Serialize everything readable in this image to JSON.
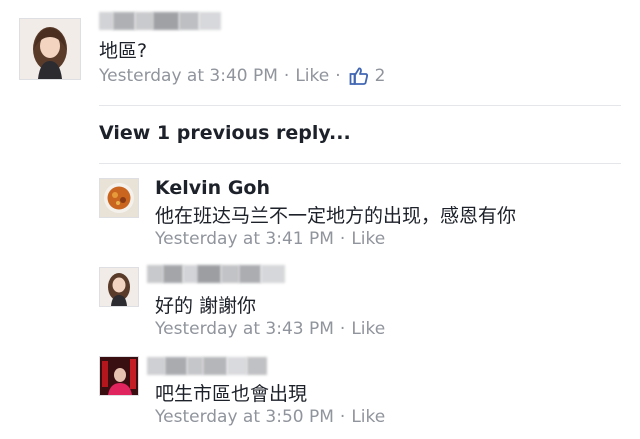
{
  "comment": {
    "author_blurred": true,
    "text": "地區?",
    "timestamp": "Yesterday at 3:40 PM",
    "like_label": "Like",
    "like_count": "2",
    "like_icon": "thumbs-up-icon",
    "accent_color": "#4267b2"
  },
  "replies_toggle": {
    "label": "View 1 previous reply..."
  },
  "replies": [
    {
      "author": "Kelvin Goh",
      "text": "他在班达马兰不一定地方的出现，感恩有你",
      "timestamp": "Yesterday at 3:41 PM",
      "like_label": "Like"
    },
    {
      "author_blurred": true,
      "text": "好的 謝謝你",
      "timestamp": "Yesterday at 3:43 PM",
      "like_label": "Like"
    },
    {
      "author_blurred": true,
      "text": "吧生市區也會出現",
      "timestamp": "Yesterday at 3:50 PM",
      "like_label": "Like"
    }
  ]
}
